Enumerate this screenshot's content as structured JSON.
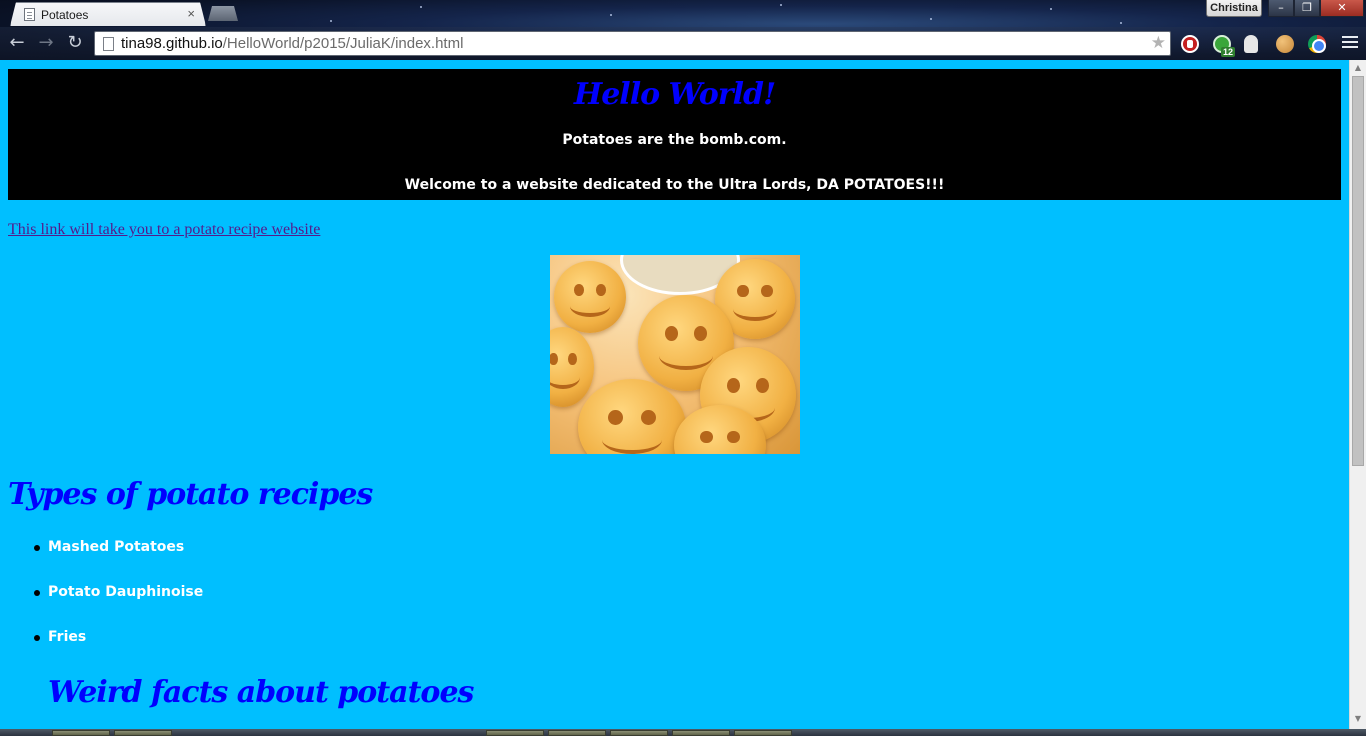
{
  "browser": {
    "tab_title": "Potatoes",
    "tab_close": "×",
    "profile_name": "Christina",
    "url_host": "tina98.github.io",
    "url_path": "/HelloWorld/p2015/JuliaK/index.html",
    "window_controls": {
      "minimize": "–",
      "restore": "❐",
      "close": "✕"
    },
    "nav": {
      "back": "←",
      "forward": "→",
      "reload": "↻",
      "bookmark": "★"
    },
    "extensions": [
      "adblock-icon",
      "green-extension-icon",
      "ghostery-icon",
      "cookie-icon",
      "chrome-icon"
    ],
    "extension_badge": "12"
  },
  "page": {
    "background_color": "#00bfff",
    "header": {
      "title": "Hello World!",
      "tagline": "Potatoes are the bomb.com.",
      "welcome": "Welcome to a website dedicated to the Ultra Lords, DA POTATOES!!!"
    },
    "recipe_link": "This link will take you to a potato recipe website",
    "image_alt": "smiley face potatoes",
    "recipes": {
      "title": "Types of potato recipes",
      "items": [
        {
          "label": "Mashed Potatoes"
        },
        {
          "label": "Potato Dauphinoise"
        },
        {
          "label": "Fries"
        }
      ]
    },
    "facts": {
      "title": "Weird facts about potatoes"
    }
  },
  "scrollbar": {
    "up": "▲",
    "down": "▼"
  }
}
